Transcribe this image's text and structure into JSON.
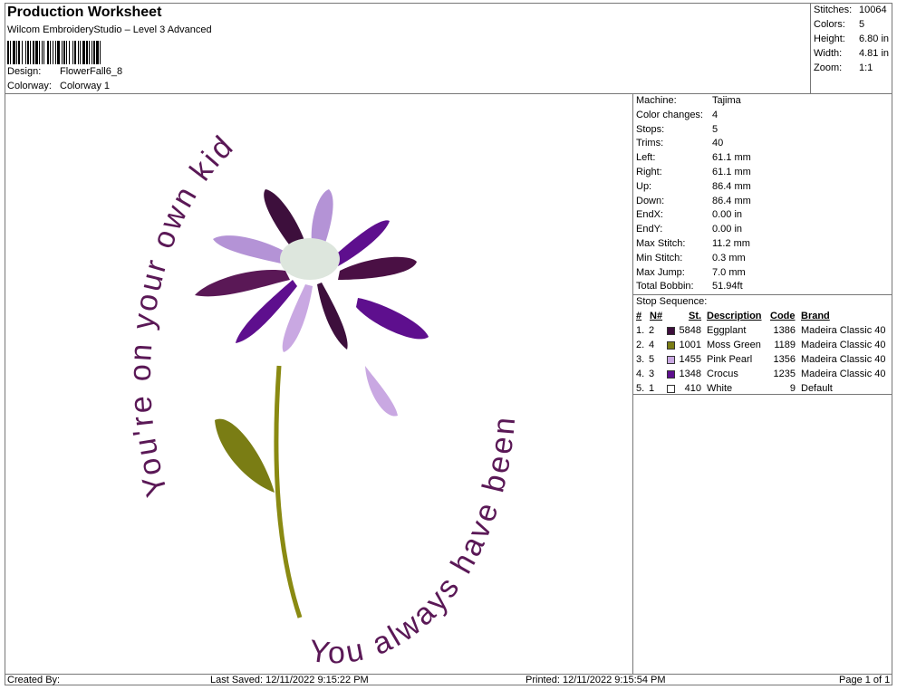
{
  "header": {
    "title": "Production Worksheet",
    "subtitle": "Wilcom EmbroideryStudio – Level 3 Advanced",
    "design_label": "Design:",
    "design_value": "FlowerFall6_8",
    "colorway_label": "Colorway:",
    "colorway_value": "Colorway 1"
  },
  "stats": [
    {
      "label": "Stitches:",
      "value": "10064"
    },
    {
      "label": "Colors:",
      "value": "5"
    },
    {
      "label": "Height:",
      "value": "6.80 in"
    },
    {
      "label": "Width:",
      "value": "4.81 in"
    },
    {
      "label": "Zoom:",
      "value": "1:1"
    }
  ],
  "machine_info": [
    {
      "label": "Machine:",
      "value": "Tajima"
    },
    {
      "label": "Color changes:",
      "value": "4"
    },
    {
      "label": "Stops:",
      "value": "5"
    },
    {
      "label": "Trims:",
      "value": "40"
    },
    {
      "label": "Left:",
      "value": "61.1 mm"
    },
    {
      "label": "Right:",
      "value": "61.1 mm"
    },
    {
      "label": "Up:",
      "value": "86.4 mm"
    },
    {
      "label": "Down:",
      "value": "86.4 mm"
    },
    {
      "label": "EndX:",
      "value": "0.00 in"
    },
    {
      "label": "EndY:",
      "value": "0.00 in"
    },
    {
      "label": "Max Stitch:",
      "value": "11.2 mm"
    },
    {
      "label": "Min Stitch:",
      "value": "0.3 mm"
    },
    {
      "label": "Max Jump:",
      "value": "7.0 mm"
    },
    {
      "label": "Total Bobbin:",
      "value": "51.94ft"
    }
  ],
  "stop_sequence": {
    "title": "Stop Sequence:",
    "headers": {
      "num": "#",
      "n": "N#",
      "st": "St.",
      "desc": "Description",
      "code": "Code",
      "brand": "Brand"
    },
    "rows": [
      {
        "num": "1.",
        "n": "2",
        "color": "#3d0f3c",
        "st": "5848",
        "desc": "Eggplant",
        "code": "1386",
        "brand": "Madeira Classic 40"
      },
      {
        "num": "2.",
        "n": "4",
        "color": "#7a7d14",
        "st": "1001",
        "desc": "Moss Green",
        "code": "1189",
        "brand": "Madeira Classic 40"
      },
      {
        "num": "3.",
        "n": "5",
        "color": "#c9a8e2",
        "st": "1455",
        "desc": "Pink Pearl",
        "code": "1356",
        "brand": "Madeira Classic 40"
      },
      {
        "num": "4.",
        "n": "3",
        "color": "#5e0f8e",
        "st": "1348",
        "desc": "Crocus",
        "code": "1235",
        "brand": "Madeira Classic 40"
      },
      {
        "num": "5.",
        "n": "1",
        "color": "#ffffff",
        "st": "410",
        "desc": "White",
        "code": "9",
        "brand": "Default"
      }
    ]
  },
  "design_text": {
    "arc_top": "You're on your own kid",
    "arc_bottom": "You always have been"
  },
  "footer": {
    "created_by": "Created By:",
    "last_saved": "Last Saved: 12/11/2022 9:15:22 PM",
    "printed": "Printed: 12/11/2022 9:15:54 PM",
    "page": "Page 1 of 1"
  }
}
